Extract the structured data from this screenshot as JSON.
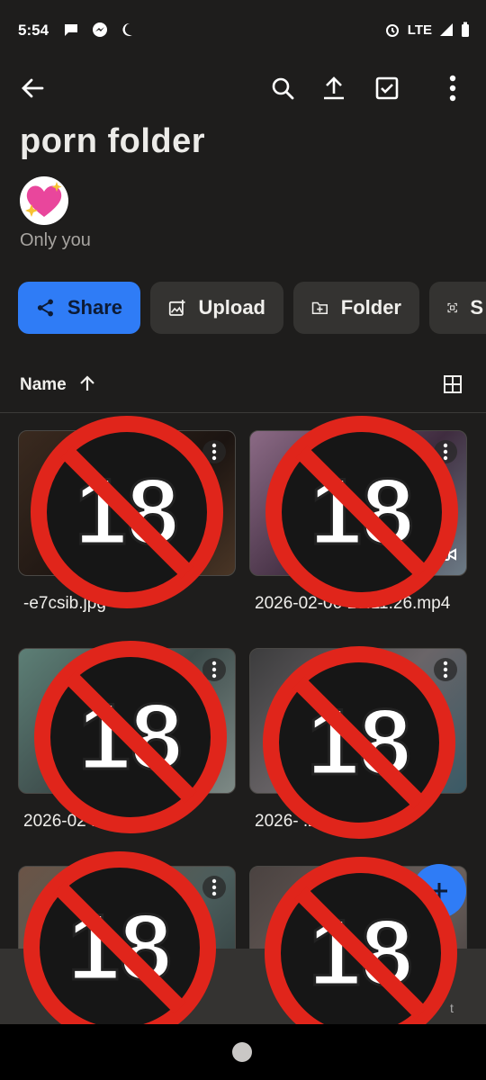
{
  "status": {
    "time": "5:54",
    "network": "LTE"
  },
  "header": {
    "title": "porn folder",
    "owner_text": "Only you"
  },
  "actions": [
    {
      "label": "Share"
    },
    {
      "label": "Upload"
    },
    {
      "label": "Folder"
    },
    {
      "label": "S"
    }
  ],
  "sort": {
    "label": "Name"
  },
  "files": [
    {
      "name": "-e7csib.jpg"
    },
    {
      "name": "2026-02-06 10.11.26.mp4"
    },
    {
      "name": "2026-02  .27.jpg"
    },
    {
      "name": "2026-  .2.jpg"
    },
    {
      "name": ""
    },
    {
      "name": ""
    }
  ],
  "badge": {
    "text": "18"
  },
  "nav": {
    "right_label": "t"
  },
  "colors": {
    "accent": "#2f7cf6",
    "background": "#1e1d1c",
    "badge_red": "#e0251b"
  }
}
